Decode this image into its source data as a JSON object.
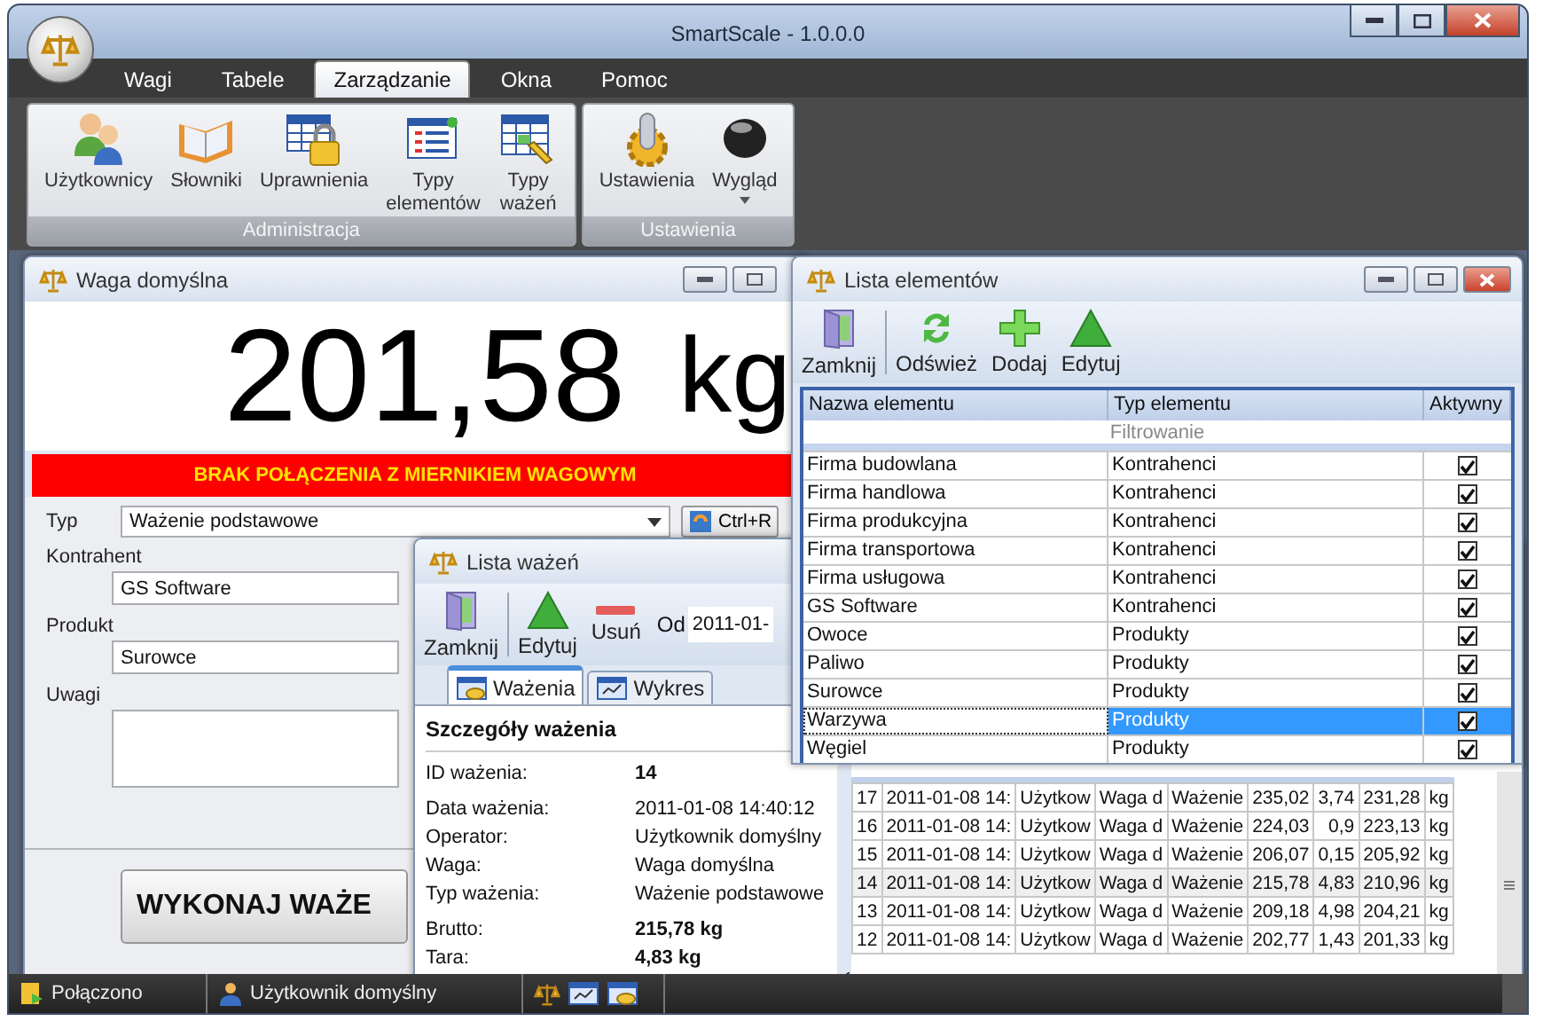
{
  "window": {
    "title": "SmartScale - 1.0.0.0"
  },
  "menu_tabs": [
    {
      "label": "Wagi",
      "selected": false
    },
    {
      "label": "Tabele",
      "selected": false
    },
    {
      "label": "Zarządzanie",
      "selected": true
    },
    {
      "label": "Okna",
      "selected": false
    },
    {
      "label": "Pomoc",
      "selected": false
    }
  ],
  "ribbon_groups": [
    {
      "title": "Administracja",
      "buttons": [
        {
          "label": "Użytkownicy"
        },
        {
          "label": "Słowniki"
        },
        {
          "label": "Uprawnienia"
        },
        {
          "label": "Typy elementów"
        },
        {
          "label": "Typy ważeń"
        }
      ]
    },
    {
      "title": "Ustawienia",
      "buttons": [
        {
          "label": "Ustawienia"
        },
        {
          "label": "Wygląd",
          "dropdown": true
        }
      ]
    }
  ],
  "scale_window": {
    "title": "Waga domyślna",
    "reading": "201,58",
    "unit": "kg",
    "alert": "BRAK POŁĄCZENIA Z MIERNIKIEM WAGOWYM",
    "fields": [
      {
        "label": "Typ",
        "value": "Ważenie podstawowe",
        "kind": "dropdown"
      },
      {
        "label": "Kontrahent",
        "value": "GS Software",
        "kind": "text"
      },
      {
        "label": "Produkt",
        "value": "Surowce",
        "kind": "text"
      },
      {
        "label": "Uwagi",
        "kind": "memo"
      }
    ],
    "shortcut_button": "Ctrl+R",
    "weigh_button": "WYKONAJ WAŻE"
  },
  "weighings_window": {
    "title": "Lista ważeń",
    "toolbar": [
      "Zamknij",
      "Edytuj",
      "Usuń"
    ],
    "from_label": "Od",
    "from_value": "2011-01-",
    "tabs": [
      {
        "label": "Ważenia",
        "selected": true
      },
      {
        "label": "Wykres",
        "selected": false
      }
    ],
    "details_title": "Szczegóły ważenia",
    "details": [
      {
        "label": "ID ważenia:",
        "value": "14",
        "bold": true
      },
      {
        "label": "Data ważenia:",
        "value": "2011-01-08 14:40:12",
        "bold": false
      },
      {
        "label": "Operator:",
        "value": "Użytkownik domyślny",
        "bold": false
      },
      {
        "label": "Waga:",
        "value": "Waga domyślna",
        "bold": false
      },
      {
        "label": "Typ ważenia:",
        "value": "Ważenie podstawowe",
        "bold": false
      },
      {
        "label": "Brutto:",
        "value": "215,78 kg",
        "bold": true
      },
      {
        "label": "Tara:",
        "value": "4,83 kg",
        "bold": true
      }
    ],
    "rows": [
      {
        "cells": [
          "17",
          "2011-01-08 14:",
          "Użytkow",
          "Waga d",
          "Ważenie",
          "235,02",
          "3,74",
          "231,28",
          "kg"
        ],
        "selected": false
      },
      {
        "cells": [
          "16",
          "2011-01-08 14:",
          "Użytkow",
          "Waga d",
          "Ważenie",
          "224,03",
          "0,9",
          "223,13",
          "kg"
        ],
        "selected": false
      },
      {
        "cells": [
          "15",
          "2011-01-08 14:",
          "Użytkow",
          "Waga d",
          "Ważenie",
          "206,07",
          "0,15",
          "205,92",
          "kg"
        ],
        "selected": false
      },
      {
        "cells": [
          "14",
          "2011-01-08 14:",
          "Użytkow",
          "Waga d",
          "Ważenie",
          "215,78",
          "4,83",
          "210,96",
          "kg"
        ],
        "selected": true
      },
      {
        "cells": [
          "13",
          "2011-01-08 14:",
          "Użytkow",
          "Waga d",
          "Ważenie",
          "209,18",
          "4,98",
          "204,21",
          "kg"
        ],
        "selected": false
      },
      {
        "cells": [
          "12",
          "2011-01-08 14:",
          "Użytkow",
          "Waga d",
          "Ważenie",
          "202,77",
          "1,43",
          "201,33",
          "kg"
        ],
        "selected": false
      }
    ]
  },
  "elements_window": {
    "title": "Lista elementów",
    "toolbar": [
      "Zamknij",
      "Odśwież",
      "Dodaj",
      "Edytuj"
    ],
    "columns": [
      "Nazwa elementu",
      "Typ elementu",
      "Aktywny"
    ],
    "filter_row": "Filtrowanie",
    "rows": [
      {
        "name": "Firma budowlana",
        "type": "Kontrahenci",
        "active": true,
        "selected": false
      },
      {
        "name": "Firma handlowa",
        "type": "Kontrahenci",
        "active": true,
        "selected": false
      },
      {
        "name": "Firma produkcyjna",
        "type": "Kontrahenci",
        "active": true,
        "selected": false
      },
      {
        "name": "Firma transportowa",
        "type": "Kontrahenci",
        "active": true,
        "selected": false
      },
      {
        "name": "Firma usługowa",
        "type": "Kontrahenci",
        "active": true,
        "selected": false
      },
      {
        "name": "GS Software",
        "type": "Kontrahenci",
        "active": true,
        "selected": false
      },
      {
        "name": "Owoce",
        "type": "Produkty",
        "active": true,
        "selected": false
      },
      {
        "name": "Paliwo",
        "type": "Produkty",
        "active": true,
        "selected": false
      },
      {
        "name": "Surowce",
        "type": "Produkty",
        "active": true,
        "selected": false
      },
      {
        "name": "Warzywa",
        "type": "Produkty",
        "active": true,
        "selected": true
      },
      {
        "name": "Węgiel",
        "type": "Produkty",
        "active": true,
        "selected": false
      }
    ]
  },
  "status_bar": [
    {
      "text": "Połączono"
    },
    {
      "text": "Użytkownik domyślny"
    }
  ]
}
